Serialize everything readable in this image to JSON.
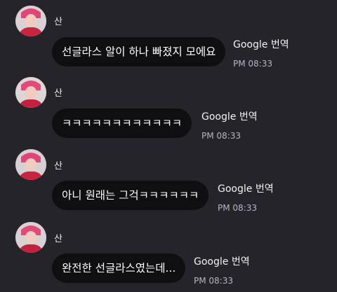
{
  "messages": [
    {
      "sender": "산",
      "text": "선글라스 알이 하나 빠졌지 모에요",
      "translate_label": "Google 번역",
      "time": "PM 08:33"
    },
    {
      "sender": "산",
      "text": "ㅋㅋㅋㅋㅋㅋㅋㅋㅋㅋㅋㅋ",
      "translate_label": "Google 번역",
      "time": "PM 08:33"
    },
    {
      "sender": "산",
      "text": "아니 원래는 그걱ㅋㅋㅋㅋㅋㅋ",
      "translate_label": "Google 번역",
      "time": "PM 08:33"
    },
    {
      "sender": "산",
      "text": "완전한 선글라스였는데...",
      "translate_label": "Google 번역",
      "time": "PM 08:33"
    }
  ],
  "colors": {
    "background": "#25242b",
    "bubble": "#0f0f12",
    "time_text": "#b4b6c6"
  },
  "icons": [
    "avatar-photo"
  ]
}
